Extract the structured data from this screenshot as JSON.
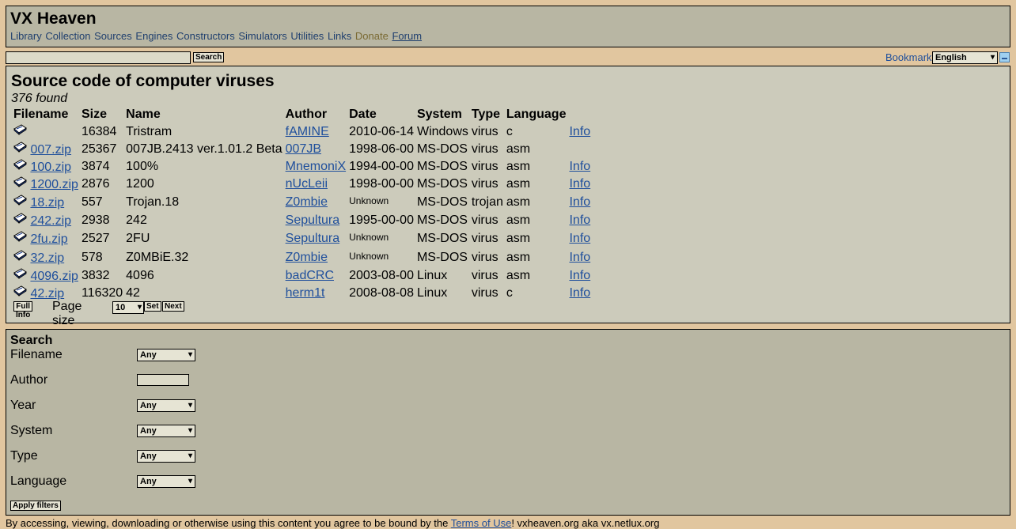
{
  "header": {
    "site_title": "VX Heaven",
    "nav": [
      "Library",
      "Collection",
      "Sources",
      "Engines",
      "Constructors",
      "Simulators",
      "Utilities",
      "Links"
    ],
    "donate": "Donate",
    "forum": "Forum"
  },
  "search_bar": {
    "value": "",
    "button": "Search",
    "bookmark": "Bookmark",
    "language": "English"
  },
  "main": {
    "title": "Source code of computer viruses",
    "found": "376 found",
    "columns": [
      "Filename",
      "Size",
      "Name",
      "Author",
      "Date",
      "System",
      "Type",
      "Language"
    ],
    "rows": [
      {
        "filename": "",
        "size": "16384",
        "name": "Tristram",
        "author": "fAMINE",
        "date": "2010-06-14",
        "system": "Windows",
        "type": "virus",
        "language": "c",
        "info": "Info"
      },
      {
        "filename": "007.zip",
        "size": "25367",
        "name": "007JB.2413 ver.1.01.2 Beta",
        "author": "007JB",
        "date": "1998-06-00",
        "system": "MS-DOS",
        "type": "virus",
        "language": "asm",
        "info": ""
      },
      {
        "filename": "100.zip",
        "size": "3874",
        "name": "100%",
        "author": "MnemoniX",
        "date": "1994-00-00",
        "system": "MS-DOS",
        "type": "virus",
        "language": "asm",
        "info": "Info"
      },
      {
        "filename": "1200.zip",
        "size": "2876",
        "name": "1200",
        "author": "nUcLeii",
        "date": "1998-00-00",
        "system": "MS-DOS",
        "type": "virus",
        "language": "asm",
        "info": "Info"
      },
      {
        "filename": "18.zip",
        "size": "557",
        "name": "Trojan.18",
        "author": "Z0mbie",
        "date": "Unknown",
        "system": "MS-DOS",
        "type": "trojan",
        "language": "asm",
        "info": "Info"
      },
      {
        "filename": "242.zip",
        "size": "2938",
        "name": "242",
        "author": "Sepultura",
        "date": "1995-00-00",
        "system": "MS-DOS",
        "type": "virus",
        "language": "asm",
        "info": "Info"
      },
      {
        "filename": "2fu.zip",
        "size": "2527",
        "name": "2FU",
        "author": "Sepultura",
        "date": "Unknown",
        "system": "MS-DOS",
        "type": "virus",
        "language": "asm",
        "info": "Info"
      },
      {
        "filename": "32.zip",
        "size": "578",
        "name": "Z0MBiE.32",
        "author": "Z0mbie",
        "date": "Unknown",
        "system": "MS-DOS",
        "type": "virus",
        "language": "asm",
        "info": "Info"
      },
      {
        "filename": "4096.zip",
        "size": "3832",
        "name": "4096",
        "author": "badCRC",
        "date": "2003-08-00",
        "system": "Linux",
        "type": "virus",
        "language": "asm",
        "info": "Info"
      },
      {
        "filename": "42.zip",
        "size": "116320",
        "name": "42",
        "author": "herm1t",
        "date": "2008-08-08",
        "system": "Linux",
        "type": "virus",
        "language": "c",
        "info": "Info"
      }
    ],
    "full_info_button": "Full Info",
    "page_size_label": "Page size",
    "page_size_value": "10",
    "set_button": "Set",
    "next_button": "Next"
  },
  "filters": {
    "title": "Search",
    "filename_label": "Filename",
    "filename_value": "Any",
    "author_label": "Author",
    "author_value": "",
    "year_label": "Year",
    "year_value": "Any",
    "system_label": "System",
    "system_value": "Any",
    "type_label": "Type",
    "type_value": "Any",
    "language_label": "Language",
    "language_value": "Any",
    "apply_button": "Apply filters"
  },
  "footer": {
    "text_before": "By accessing, viewing, downloading or otherwise using this content you agree to be bound by the ",
    "terms_link": "Terms of Use",
    "text_after": "! vxheaven.org aka vx.netlux.org"
  }
}
